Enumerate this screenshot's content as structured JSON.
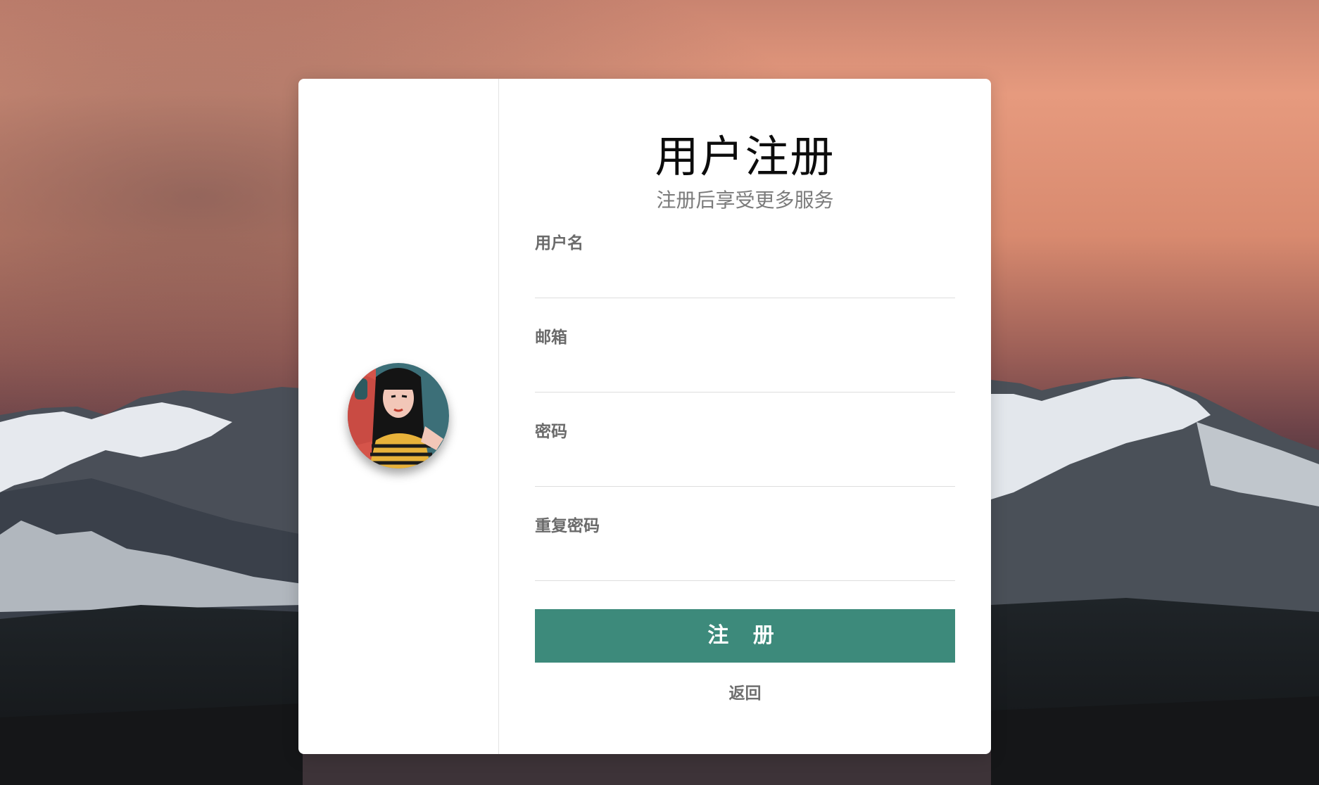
{
  "form": {
    "title": "用户注册",
    "subtitle": "注册后享受更多服务",
    "fields": [
      {
        "label": "用户名",
        "value": "",
        "type": "text"
      },
      {
        "label": "邮箱",
        "value": "",
        "type": "email"
      },
      {
        "label": "密码",
        "value": "",
        "type": "password"
      },
      {
        "label": "重复密码",
        "value": "",
        "type": "password"
      }
    ],
    "submit_label": "注 册",
    "back_label": "返回"
  },
  "theme": {
    "accent": "#3d8a7b",
    "sky_top": "#e3957a",
    "card_bg": "#ffffff"
  }
}
